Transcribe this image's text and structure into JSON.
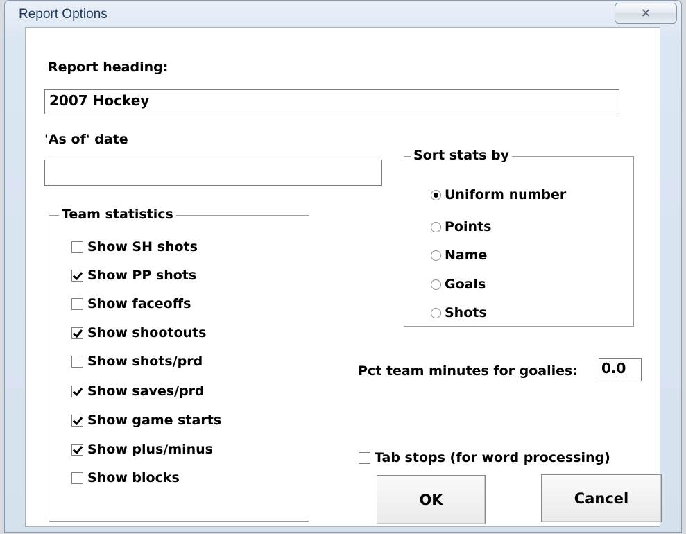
{
  "window": {
    "title": "Report Options",
    "close_glyph": "✕"
  },
  "report_heading": {
    "label": "Report heading:",
    "value": "2007 Hockey"
  },
  "as_of_date": {
    "label": "'As of' date",
    "value": ""
  },
  "team_statistics": {
    "legend": "Team statistics",
    "items": [
      {
        "label": "Show SH shots",
        "checked": false
      },
      {
        "label": "Show PP shots",
        "checked": true
      },
      {
        "label": "Show faceoffs",
        "checked": false
      },
      {
        "label": "Show shootouts",
        "checked": true
      },
      {
        "label": "Show shots/prd",
        "checked": false
      },
      {
        "label": "Show saves/prd",
        "checked": true
      },
      {
        "label": "Show game starts",
        "checked": true
      },
      {
        "label": "Show plus/minus",
        "checked": true
      },
      {
        "label": "Show blocks",
        "checked": false
      }
    ]
  },
  "sort_stats_by": {
    "legend": "Sort stats by",
    "selected": "Uniform number",
    "options": [
      "Uniform number",
      "Points",
      "Name",
      "Goals",
      "Shots"
    ]
  },
  "goalie_minutes": {
    "label": "Pct team minutes for goalies:",
    "value": "0.0"
  },
  "tab_stops": {
    "label": "Tab stops (for word processing)",
    "checked": false
  },
  "buttons": {
    "ok": "OK",
    "cancel": "Cancel"
  }
}
